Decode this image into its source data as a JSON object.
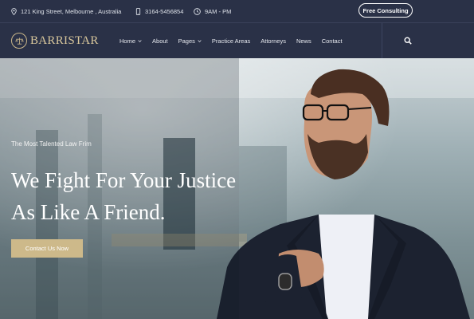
{
  "topbar": {
    "address": "121 King Street, Melbourne , Australia",
    "phone": "3164-5456854",
    "hours": "9AM - PM",
    "cta_label": "Free Consulting"
  },
  "brand": {
    "name": "BARRISTAR"
  },
  "nav": {
    "items": [
      {
        "label": "Home",
        "has_dropdown": true
      },
      {
        "label": "About",
        "has_dropdown": false
      },
      {
        "label": "Pages",
        "has_dropdown": true
      },
      {
        "label": "Practice Areas",
        "has_dropdown": false
      },
      {
        "label": "Attorneys",
        "has_dropdown": false
      },
      {
        "label": "News",
        "has_dropdown": false
      },
      {
        "label": "Contact",
        "has_dropdown": false
      }
    ]
  },
  "hero": {
    "kicker": "The Most Talented Law Frim",
    "title_line1": "We Fight For Your Justice",
    "title_line2": "As Like A Friend.",
    "cta_label": "Contact Us Now"
  },
  "colors": {
    "navy": "#2a3147",
    "gold": "#cdb98a"
  },
  "icons": [
    "location-icon",
    "phone-icon",
    "clock-icon",
    "chevron-down-icon",
    "search-icon",
    "scales-logo-icon"
  ]
}
